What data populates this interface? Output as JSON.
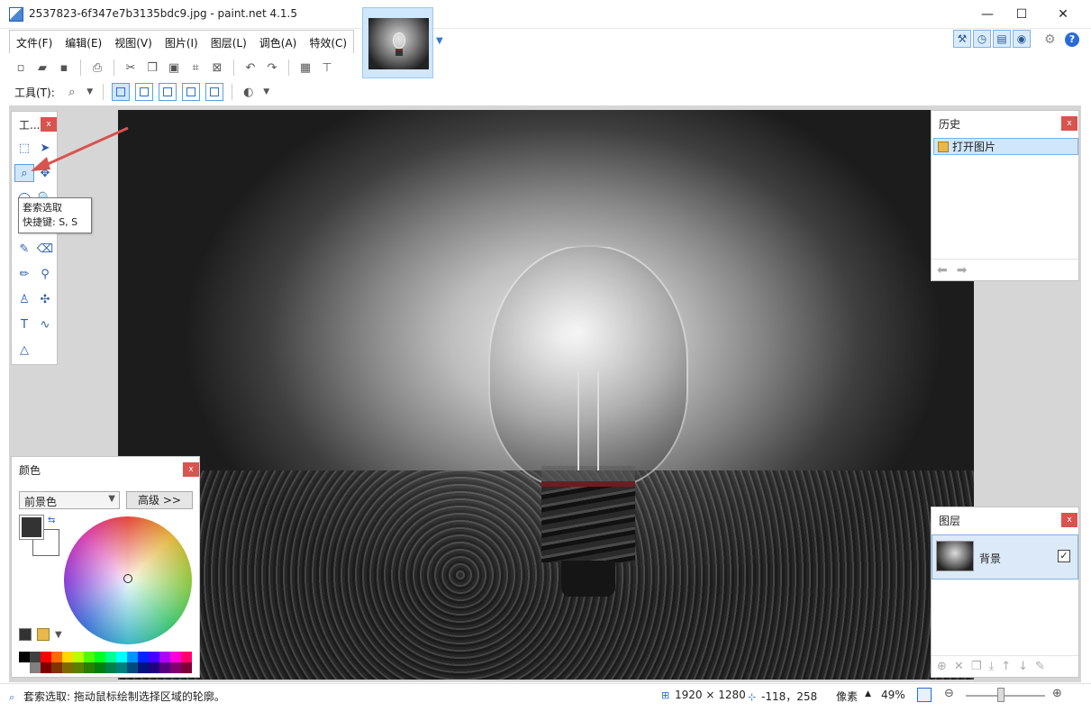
{
  "window": {
    "title": "2537823-6f347e7b3135bdc9.jpg - paint.net 4.1.5",
    "minimize": "—",
    "maximize": "☐",
    "close": "✕"
  },
  "menu": [
    "文件(F)",
    "编辑(E)",
    "视图(V)",
    "图片(I)",
    "图层(L)",
    "调色(A)",
    "特效(C)"
  ],
  "toolbar": {
    "tool_label": "工具(T):"
  },
  "tools_panel": {
    "title": "工...",
    "close": "x"
  },
  "tooltip": {
    "line1": "套索选取",
    "line2": "快捷键: S, S"
  },
  "history_panel": {
    "title": "历史",
    "close": "x",
    "items": [
      "打开图片"
    ]
  },
  "layers_panel": {
    "title": "图层",
    "close": "x",
    "layer_name": "背景",
    "check": "✓"
  },
  "color_panel": {
    "title": "颜色",
    "close": "x",
    "select_value": "前景色",
    "advanced_button": "高级 >>"
  },
  "status": {
    "hint": "套索选取: 拖动鼠标绘制选择区域的轮廓。",
    "image_size": "1920 × 1280",
    "cursor_pos": "-118，258",
    "unit": "像素",
    "zoom": "49%"
  },
  "colors": {
    "accent": "#2a6bd6",
    "selection": "#cfe6fb",
    "close_red": "#d9534f"
  }
}
